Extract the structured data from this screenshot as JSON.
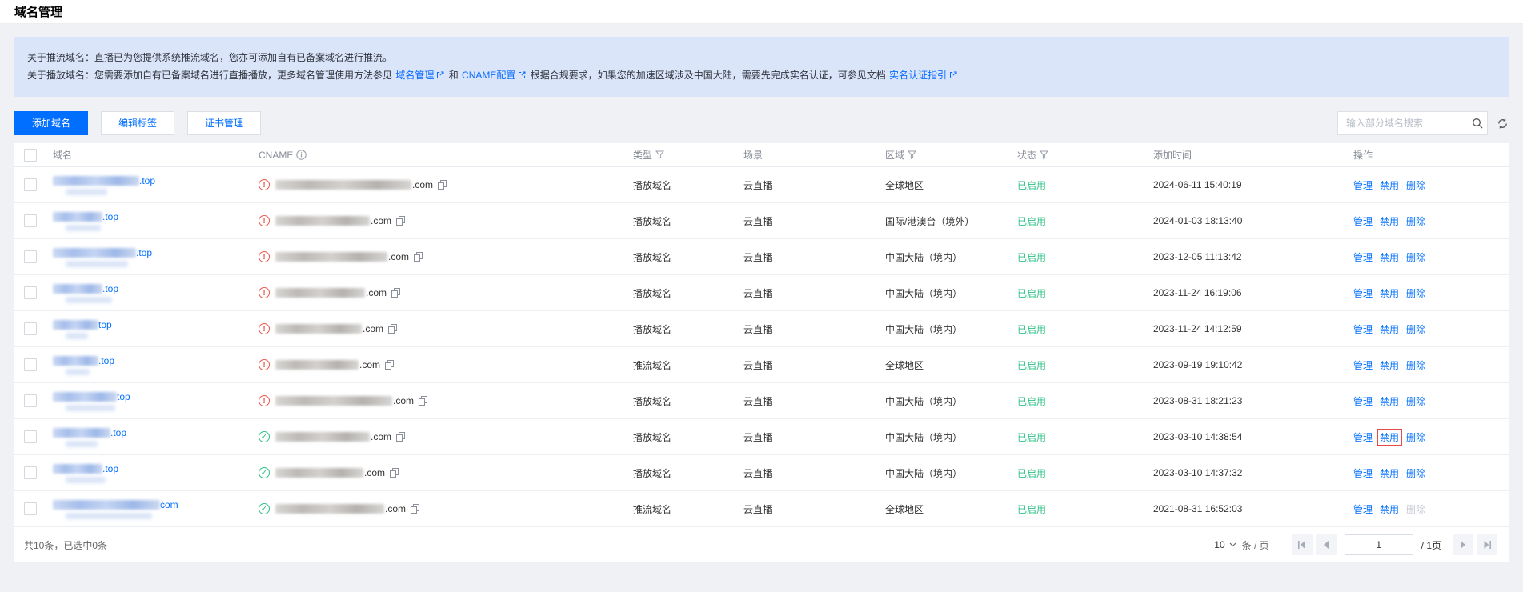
{
  "page": {
    "title": "域名管理"
  },
  "colors": {
    "accent": "#006eff",
    "success": "#2fc287",
    "warning": "#e8574c",
    "highlight_box": "#e8494d",
    "banner_bg": "#dae5fa"
  },
  "banner": {
    "line1": "关于推流域名：直播已为您提供系统推流域名，您亦可添加自有已备案域名进行推流。",
    "line2_part1": "关于播放域名：您需要添加自有已备案域名进行直播播放，更多域名管理使用方法参见 ",
    "line2_link1": "域名管理",
    "line2_part2": " 和 ",
    "line2_link2": "CNAME配置",
    "line2_part3": " 根据合规要求，如果您的加速区域涉及中国大陆，需要先完成实名认证，可参见文档 ",
    "line2_link3": "实名认证指引"
  },
  "toolbar": {
    "add_domain": "添加域名",
    "edit_tags": "编辑标签",
    "cert_management": "证书管理",
    "search_placeholder": "输入部分域名搜索"
  },
  "table": {
    "headers": {
      "domain": "域名",
      "cname": "CNAME",
      "type": "类型",
      "scene": "场景",
      "region": "区域",
      "status": "状态",
      "added_time": "添加时间",
      "actions": "操作"
    },
    "actions_labels": {
      "manage": "管理",
      "disable": "禁用",
      "delete": "删除"
    },
    "rows": [
      {
        "domain_suffix": ".top",
        "domain_blur": 108,
        "domain_sub_blur": 52,
        "cname_ok": false,
        "cname_blur": 170,
        "cname_suffix": ".com",
        "type": "播放域名",
        "scene": "云直播",
        "region": "全球地区",
        "status": "已启用",
        "added": "2024-06-11 15:40:19",
        "highlight_disable": false,
        "delete_disabled": false
      },
      {
        "domain_suffix": ".top",
        "domain_blur": 62,
        "domain_sub_blur": 44,
        "cname_ok": false,
        "cname_blur": 118,
        "cname_suffix": ".com",
        "type": "播放域名",
        "scene": "云直播",
        "region": "国际/港澳台（境外）",
        "status": "已启用",
        "added": "2024-01-03 18:13:40",
        "highlight_disable": false,
        "delete_disabled": false
      },
      {
        "domain_suffix": ".top",
        "domain_blur": 104,
        "domain_sub_blur": 78,
        "cname_ok": false,
        "cname_blur": 140,
        "cname_suffix": ".com",
        "type": "播放域名",
        "scene": "云直播",
        "region": "中国大陆（境内）",
        "status": "已启用",
        "added": "2023-12-05 11:13:42",
        "highlight_disable": false,
        "delete_disabled": false
      },
      {
        "domain_suffix": ".top",
        "domain_blur": 62,
        "domain_sub_blur": 58,
        "cname_ok": false,
        "cname_blur": 112,
        "cname_suffix": ".com",
        "type": "播放域名",
        "scene": "云直播",
        "region": "中国大陆（境内）",
        "status": "已启用",
        "added": "2023-11-24 16:19:06",
        "highlight_disable": false,
        "delete_disabled": false
      },
      {
        "domain_suffix": "top",
        "domain_blur": 57,
        "domain_sub_blur": 28,
        "cname_ok": false,
        "cname_blur": 108,
        "cname_suffix": ".com",
        "type": "播放域名",
        "scene": "云直播",
        "region": "中国大陆（境内）",
        "status": "已启用",
        "added": "2023-11-24 14:12:59",
        "highlight_disable": false,
        "delete_disabled": false
      },
      {
        "domain_suffix": ".top",
        "domain_blur": 57,
        "domain_sub_blur": 30,
        "cname_ok": false,
        "cname_blur": 104,
        "cname_suffix": ".com",
        "type": "推流域名",
        "scene": "云直播",
        "region": "全球地区",
        "status": "已启用",
        "added": "2023-09-19 19:10:42",
        "highlight_disable": false,
        "delete_disabled": false
      },
      {
        "domain_suffix": "top",
        "domain_blur": 80,
        "domain_sub_blur": 62,
        "cname_ok": false,
        "cname_blur": 146,
        "cname_suffix": ".com",
        "type": "播放域名",
        "scene": "云直播",
        "region": "中国大陆（境内）",
        "status": "已启用",
        "added": "2023-08-31 18:21:23",
        "highlight_disable": false,
        "delete_disabled": false
      },
      {
        "domain_suffix": ".top",
        "domain_blur": 72,
        "domain_sub_blur": 40,
        "cname_ok": true,
        "cname_blur": 118,
        "cname_suffix": ".com",
        "type": "播放域名",
        "scene": "云直播",
        "region": "中国大陆（境内）",
        "status": "已启用",
        "added": "2023-03-10 14:38:54",
        "highlight_disable": true,
        "delete_disabled": false
      },
      {
        "domain_suffix": ".top",
        "domain_blur": 62,
        "domain_sub_blur": 50,
        "cname_ok": true,
        "cname_blur": 110,
        "cname_suffix": ".com",
        "type": "播放域名",
        "scene": "云直播",
        "region": "中国大陆（境内）",
        "status": "已启用",
        "added": "2023-03-10 14:37:32",
        "highlight_disable": false,
        "delete_disabled": false
      },
      {
        "domain_suffix": "com",
        "domain_blur": 134,
        "domain_sub_blur": 108,
        "cname_ok": true,
        "cname_blur": 136,
        "cname_suffix": ".com",
        "type": "推流域名",
        "scene": "云直播",
        "region": "全球地区",
        "status": "已启用",
        "added": "2021-08-31 16:52:03",
        "highlight_disable": false,
        "delete_disabled": true
      }
    ]
  },
  "footer": {
    "summary": "共10条，已选中0条",
    "page_size": "10",
    "unit": "条 / 页",
    "current_page": "1",
    "page_total": "/ 1页"
  }
}
